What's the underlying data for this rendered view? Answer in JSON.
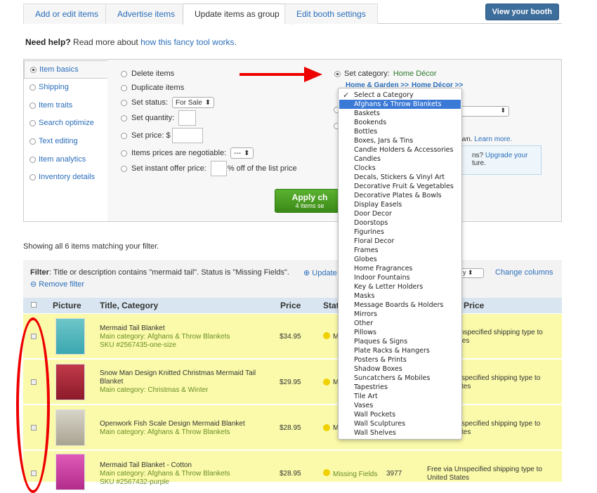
{
  "tabs": [
    "Add or edit items",
    "Advertise items",
    "Update items as group",
    "Edit booth settings"
  ],
  "view_booth": "View your booth",
  "help": {
    "bold": "Need help?",
    "text": " Read more about ",
    "link": "how this fancy tool works",
    "end": "."
  },
  "side": [
    "Item basics",
    "Shipping",
    "Item traits",
    "Search optimize",
    "Text editing",
    "Item analytics",
    "Inventory details"
  ],
  "options": {
    "delete": "Delete items",
    "duplicate": "Duplicate items",
    "status": "Set status:",
    "status_value": "For Sale",
    "quantity": "Set quantity:",
    "price": "Set price: $",
    "negotiable": "Items prices are negotiable:",
    "negotiable_value": "---",
    "instant": "Set instant offer price:",
    "instant_suffix": "% off of the list price"
  },
  "set_category": {
    "label": "Set category:",
    "value": "Home Décor",
    "bc1": "Home & Garden >>",
    "bc2": "Home Décor >>"
  },
  "right_bits": {
    "learn_prefix": "wn.",
    "learn": "Learn more.",
    "upgrade_prefix": "ns?",
    "upgrade": "Upgrade your",
    "upgrade2": "ture."
  },
  "apply": {
    "label": "Apply ch",
    "sub": "4 items se"
  },
  "showing": "Showing all 6 items matching your filter.",
  "filter": {
    "label": "Filter",
    "text": ": Title or description contains \"mermaid tail\". Status is \"Missing Fields\".",
    "remove": "Remove filter",
    "update": "Update",
    "change_columns": "Change columns",
    "select_suffix": "y"
  },
  "columns": {
    "picture": "Picture",
    "title": "Title, Category",
    "price": "Price",
    "status": "Stat",
    "ship_price": "Price"
  },
  "rows": [
    {
      "title": "Mermaid Tail Blanket",
      "category": "Main category: Afghans & Throw Blankets",
      "sku": "SKU #2567435-one-size",
      "price": "$34.95",
      "status": "M",
      "ship": "nspecified shipping type to",
      "ship2": "tes"
    },
    {
      "title": "Snow Man Design Knitted Christmas Mermaid Tail",
      "title2": "Blanket",
      "category": "Main category: Christmas & Winter",
      "price": "$29.95",
      "status": "M",
      "ship": "specified shipping type to",
      "ship2": "tes"
    },
    {
      "title": "Openwork Fish Scale Design Mermaid Blanket",
      "category": "Main category: Afghans & Throw Blankets",
      "price": "$28.95",
      "status": "M",
      "ship": "specified shipping type to",
      "ship2": "tes"
    },
    {
      "title": "Mermaid Tail Blanket - Cotton",
      "category": "Main category: Afghans & Throw Blankets",
      "sku": "SKU #2567432-purple",
      "price": "$28.95",
      "status": "Missing Fields",
      "qty": "3977",
      "ship": "Free via Unspecified shipping type to",
      "ship2": "United States"
    }
  ],
  "dropdown": [
    "Select a Category",
    "Afghans & Throw Blankets",
    "Baskets",
    "Bookends",
    "Bottles",
    "Boxes, Jars & Tins",
    "Candle Holders & Accessories",
    "Candles",
    "Clocks",
    "Decals, Stickers & Vinyl Art",
    "Decorative Fruit & Vegetables",
    "Decorative Plates & Bowls",
    "Display Easels",
    "Door Decor",
    "Doorstops",
    "Figurines",
    "Floral Decor",
    "Frames",
    "Globes",
    "Home Fragrances",
    "Indoor Fountains",
    "Key & Letter Holders",
    "Masks",
    "Message Boards & Holders",
    "Mirrors",
    "Other",
    "Pillows",
    "Plaques & Signs",
    "Plate Racks & Hangers",
    "Posters & Prints",
    "Shadow Boxes",
    "Suncatchers & Mobiles",
    "Tapestries",
    "Tile Art",
    "Vases",
    "Wall Pockets",
    "Wall Sculptures",
    "Wall Shelves"
  ]
}
